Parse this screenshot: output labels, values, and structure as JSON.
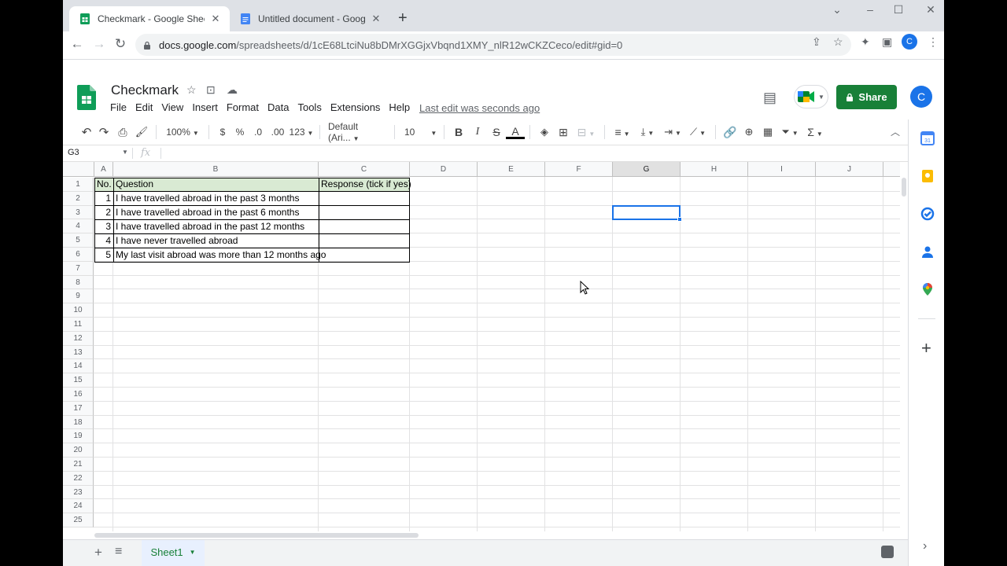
{
  "browser": {
    "tabs": [
      {
        "title": "Checkmark - Google Sheets",
        "close": "✕",
        "active": true
      },
      {
        "title": "Untitled document - Google Doc",
        "close": "✕",
        "active": false
      }
    ],
    "new_tab": "+",
    "url_host": "docs.google.com",
    "url_path": "/spreadsheets/d/1cE68LtciNu8bDMrXGGjxVbqnd1XMY_nlR12wCKZCeco/edit#gid=0",
    "profile_initial": "C"
  },
  "sheets": {
    "doc_title": "Checkmark",
    "menu": [
      "File",
      "Edit",
      "View",
      "Insert",
      "Format",
      "Data",
      "Tools",
      "Extensions",
      "Help"
    ],
    "last_edit": "Last edit was seconds ago",
    "share_label": "Share",
    "account_initial": "C",
    "toolbar": {
      "zoom": "100%",
      "currency": "$",
      "percent": "%",
      "decrease_decimal": ".0",
      "increase_decimal": ".00",
      "more_formats": "123",
      "font": "Default (Ari...",
      "font_size": "10",
      "bold": "B",
      "italic": "I",
      "strike": "S",
      "text_color": "A"
    },
    "name_box": "G3",
    "fx": "fx",
    "columns": [
      "A",
      "B",
      "C",
      "D",
      "E",
      "F",
      "G",
      "H",
      "I",
      "J"
    ],
    "selected_column": "G",
    "rows": [
      "1",
      "2",
      "3",
      "4",
      "5",
      "6",
      "7",
      "8",
      "9",
      "10",
      "11",
      "12",
      "13",
      "14",
      "15",
      "16",
      "17",
      "18",
      "19",
      "20",
      "21",
      "22",
      "23",
      "24",
      "25"
    ],
    "table": {
      "header": {
        "no": "No.",
        "question": "Question",
        "response": "Response (tick if yes)"
      },
      "rows": [
        {
          "no": "1",
          "question": "I have travelled abroad in the past 3 months"
        },
        {
          "no": "2",
          "question": "I have travelled abroad in the past 6 months"
        },
        {
          "no": "3",
          "question": "I have travelled abroad in the past 12 months"
        },
        {
          "no": "4",
          "question": "I have never travelled abroad"
        },
        {
          "no": "5",
          "question": "My last visit abroad was more than 12 months ago"
        }
      ]
    },
    "sheet_tab": "Sheet1",
    "header_fill": "#d9ead3",
    "accent": "#188038"
  }
}
